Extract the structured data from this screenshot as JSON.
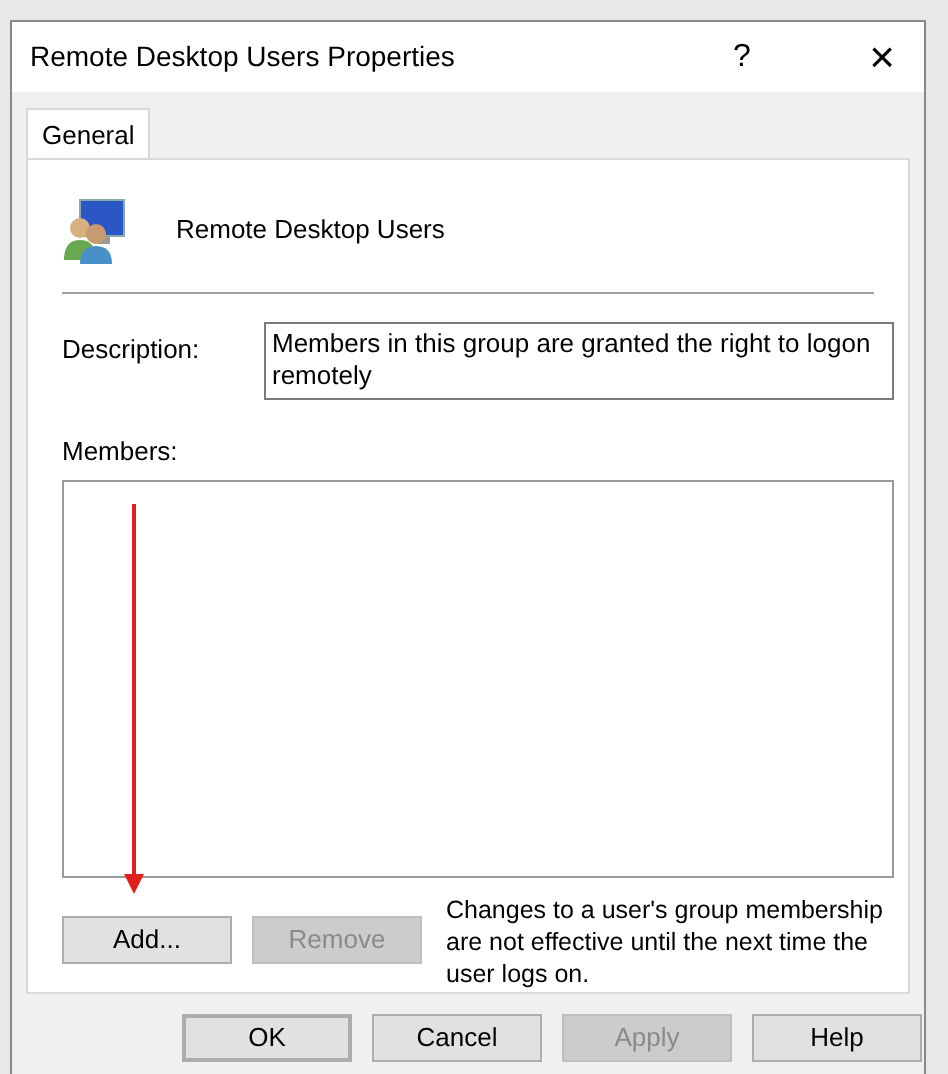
{
  "window": {
    "title": "Remote Desktop Users Properties",
    "help": "?",
    "close": "×"
  },
  "tabs": [
    {
      "label": "General",
      "selected": true
    }
  ],
  "group": {
    "name": "Remote Desktop Users"
  },
  "description": {
    "label": "Description:",
    "value": "Members in this group are granted the right to logon remotely"
  },
  "members": {
    "label": "Members:"
  },
  "member_buttons": [
    {
      "label": "Add...",
      "disabled": false
    },
    {
      "label": "Remove",
      "disabled": true
    }
  ],
  "note": "Changes to a user's group membership are not effective until the next time the user logs on.",
  "buttons": [
    {
      "label": "OK",
      "disabled": false,
      "default": true
    },
    {
      "label": "Cancel",
      "disabled": false,
      "default": false
    },
    {
      "label": "Apply",
      "disabled": true,
      "default": false
    },
    {
      "label": "Help",
      "disabled": false,
      "default": false
    }
  ]
}
